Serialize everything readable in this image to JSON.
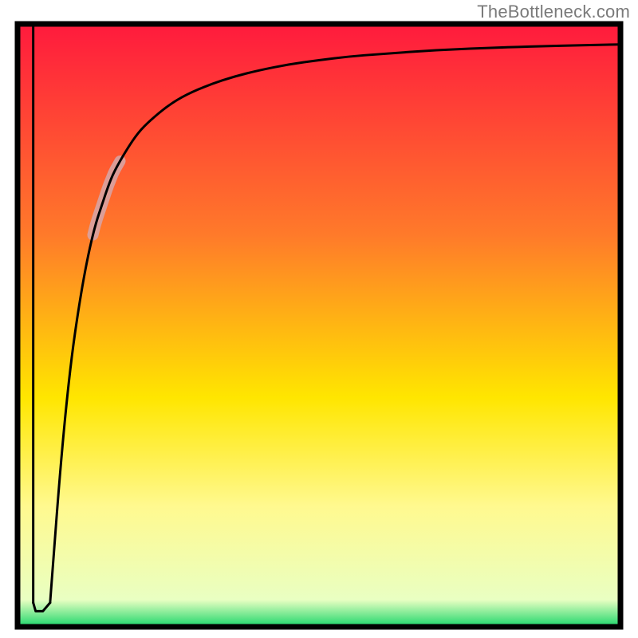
{
  "watermark": "TheBottleneck.com",
  "chart_data": {
    "type": "line",
    "title": "",
    "xlabel": "",
    "ylabel": "",
    "xlim": [
      0,
      100
    ],
    "ylim": [
      0,
      100
    ],
    "grid": false,
    "legend": false,
    "annotations": [],
    "background_gradient": {
      "stops": [
        {
          "offset": 0.0,
          "color": "#ff1a3d"
        },
        {
          "offset": 0.35,
          "color": "#ff7a2a"
        },
        {
          "offset": 0.62,
          "color": "#ffe600"
        },
        {
          "offset": 0.8,
          "color": "#fff98f"
        },
        {
          "offset": 0.955,
          "color": "#e9ffc2"
        },
        {
          "offset": 1.0,
          "color": "#1bd66a"
        }
      ]
    },
    "series": [
      {
        "name": "left-edge-drop",
        "x": [
          2.6,
          2.6
        ],
        "values": [
          100,
          4
        ],
        "stroke": "#000000",
        "width": 3
      },
      {
        "name": "notch-bottom",
        "x": [
          2.6,
          3.0,
          4.2,
          5.4
        ],
        "values": [
          4,
          2.6,
          2.6,
          4
        ],
        "stroke": "#000000",
        "width": 3
      },
      {
        "name": "main-curve",
        "x": [
          5.4,
          6,
          7,
          8,
          9,
          10,
          11,
          12,
          13,
          14,
          15,
          16,
          18,
          20,
          22,
          25,
          28,
          32,
          36,
          40,
          45,
          50,
          55,
          60,
          70,
          80,
          90,
          100
        ],
        "values": [
          4,
          12,
          25,
          36,
          45,
          52,
          58,
          63,
          67,
          70,
          73,
          75.5,
          79,
          82,
          84,
          86.5,
          88.3,
          90,
          91.3,
          92.3,
          93.3,
          94,
          94.6,
          95,
          95.7,
          96.1,
          96.4,
          96.6
        ],
        "stroke": "#000000",
        "width": 3
      }
    ],
    "band": {
      "name": "highlight-band",
      "along": "main-curve",
      "x_start": 12.5,
      "x_end": 17.0,
      "color": "#d8a3a3",
      "opacity": 0.9,
      "thickness": 14
    }
  }
}
